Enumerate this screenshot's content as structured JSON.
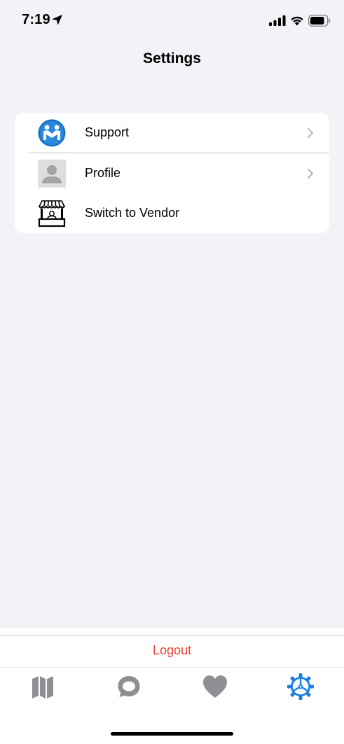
{
  "status_bar": {
    "time": "7:19",
    "icons": [
      "location-arrow-icon",
      "cellular-signal-icon",
      "wifi-icon",
      "battery-icon"
    ]
  },
  "header": {
    "title": "Settings"
  },
  "settings": {
    "rows": [
      {
        "label": "Support",
        "icon": "support-handshake-icon",
        "has_chevron": true
      },
      {
        "label": "Profile",
        "icon": "profile-avatar-icon",
        "has_chevron": true
      },
      {
        "label": "Switch to Vendor",
        "icon": "vendor-stall-icon",
        "has_chevron": false
      }
    ]
  },
  "footer": {
    "logout_label": "Logout",
    "logout_color": "#e94234"
  },
  "tab_bar": {
    "tabs": [
      {
        "icon": "map-icon",
        "active": false
      },
      {
        "icon": "chat-bubble-icon",
        "active": false
      },
      {
        "icon": "heart-icon",
        "active": false
      },
      {
        "icon": "settings-gear-icon",
        "active": true
      }
    ],
    "active_color": "#1a7fe0",
    "inactive_color": "#8e8e93"
  }
}
